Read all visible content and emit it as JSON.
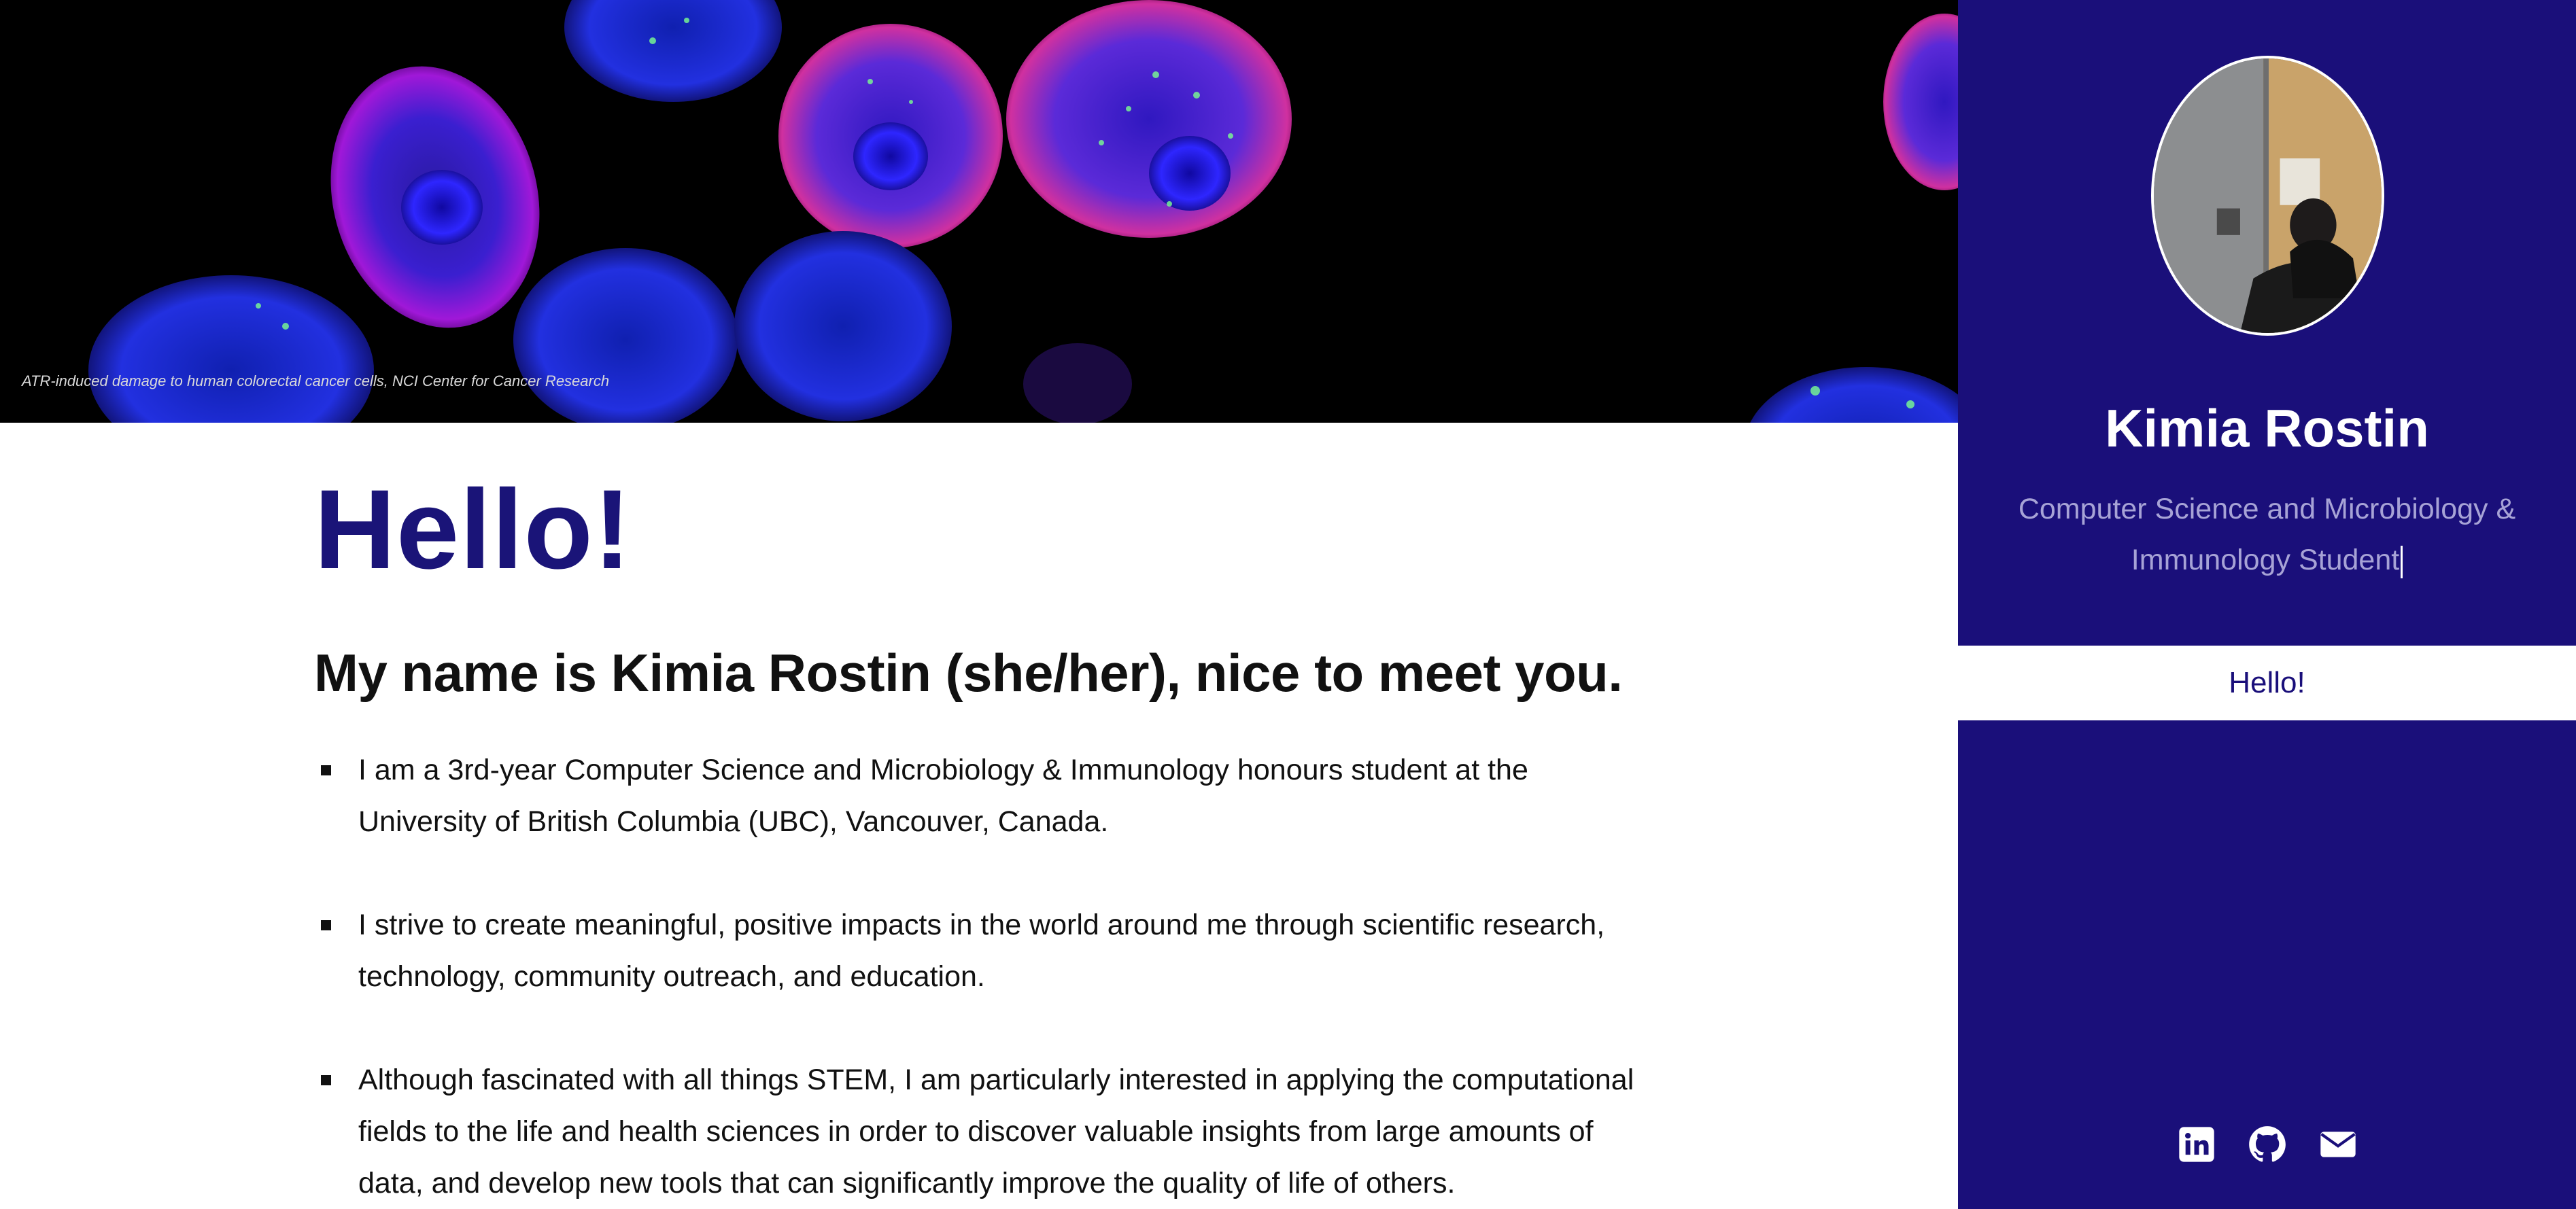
{
  "hero": {
    "caption": "ATR-induced damage to human colorectal cancer cells, NCI Center for Cancer Research"
  },
  "main": {
    "heading": "Hello!",
    "intro": "My name is Kimia Rostin (she/her), nice to meet you.",
    "bullets": [
      {
        "line1": "I am a 3rd-year Computer Science and Microbiology & Immunology honours student at the",
        "line2": "University of British Columbia (UBC), Vancouver, Canada."
      },
      {
        "line1": "I strive to create meaningful, positive impacts in the world around me through scientific research,",
        "line2": "technology, community outreach, and education."
      },
      {
        "line1": "Although fascinated with all things STEM, I am particularly interested in applying the computational",
        "line2": "fields to the life and health sciences in order to discover valuable insights from large amounts of",
        "line3": "data, and develop new tools that can significantly improve the quality of life of others."
      }
    ]
  },
  "sidebar": {
    "name": "Kimia Rostin",
    "subtitle_line1": "Computer Science and Microbiology &",
    "subtitle_line2": "Immunology Student",
    "nav": [
      {
        "label": "Hello!"
      }
    ],
    "social_icons": [
      "linkedin-icon",
      "github-icon",
      "email-icon"
    ]
  },
  "colors": {
    "accent": "#1a1478",
    "sidebar_bg": "#1a0f7a",
    "subtitle": "#a7a3d6"
  }
}
